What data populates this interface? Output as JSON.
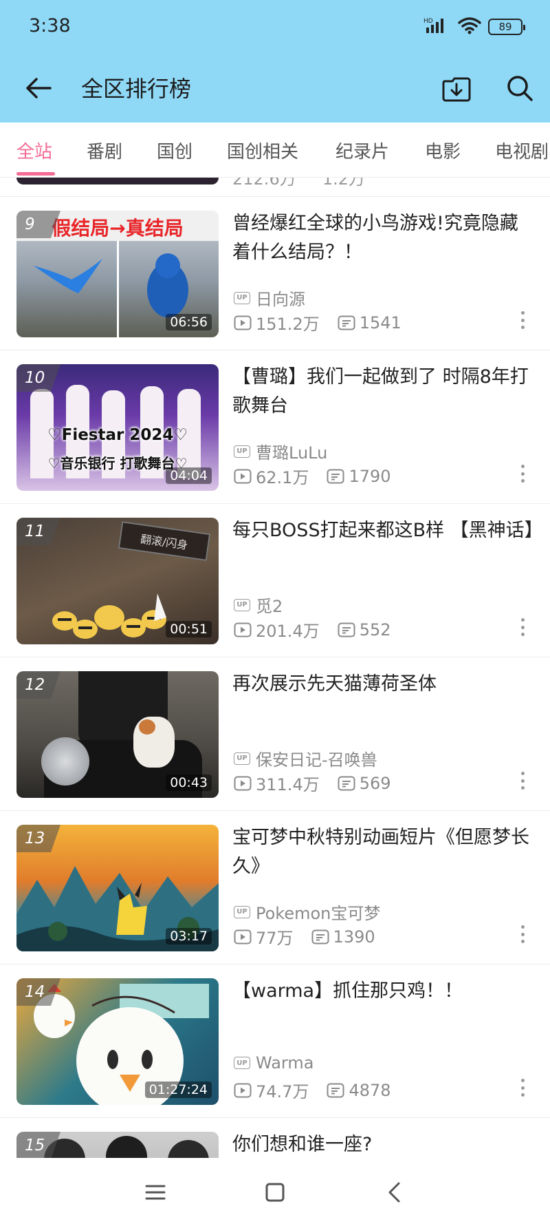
{
  "status_bar": {
    "time": "3:38",
    "network": "HD",
    "battery": "89"
  },
  "app_bar": {
    "title": "全区排行榜"
  },
  "tabs": [
    {
      "label": "全站",
      "active": true
    },
    {
      "label": "番剧"
    },
    {
      "label": "国创"
    },
    {
      "label": "国创相关"
    },
    {
      "label": "纪录片"
    },
    {
      "label": "电影"
    },
    {
      "label": "电视剧"
    }
  ],
  "partial_previous_item": {
    "views": "212.6万",
    "comments": "1.2万"
  },
  "videos": [
    {
      "rank": "9",
      "thumb_caption": "假结局→真结局",
      "duration": "06:56",
      "title": "曾经爆红全球的小鸟游戏!究竟隐藏着什么结局？！",
      "uploader": "日向源",
      "views": "151.2万",
      "comments": "1541"
    },
    {
      "rank": "10",
      "thumb_caption": "♡Fiestar 2024♡",
      "thumb_caption2": "♡音乐银行 打歌舞台♡",
      "duration": "04:04",
      "title": "【曹璐】我们一起做到了 时隔8年打歌舞台",
      "uploader": "曹璐LuLu",
      "views": "62.1万",
      "comments": "1790"
    },
    {
      "rank": "11",
      "thumb_caption": "翻滚/闪身",
      "duration": "00:51",
      "title": "每只BOSS打起来都这B样 【黑神话】",
      "uploader": "觅2",
      "views": "201.4万",
      "comments": "552"
    },
    {
      "rank": "12",
      "duration": "00:43",
      "title": "再次展示先天猫薄荷圣体",
      "uploader": "保安日记-召唤兽",
      "views": "311.4万",
      "comments": "569"
    },
    {
      "rank": "13",
      "duration": "03:17",
      "title": "宝可梦中秋特别动画短片《但愿梦长久》",
      "uploader": "Pokemon宝可梦",
      "views": "77万",
      "comments": "1390"
    },
    {
      "rank": "14",
      "duration": "01:27:24",
      "title": "【warma】抓住那只鸡！！",
      "uploader": "Warma",
      "views": "74.7万",
      "comments": "4878"
    },
    {
      "rank": "15",
      "title": "你们想和谁一座?"
    }
  ],
  "colors": {
    "header_bg": "#8fd9f7",
    "accent": "#f46b95",
    "meta_text": "#8a8a8a"
  },
  "icons": {
    "up_badge": "UP",
    "back": "back-arrow-icon",
    "download": "download-icon",
    "search": "search-icon"
  }
}
